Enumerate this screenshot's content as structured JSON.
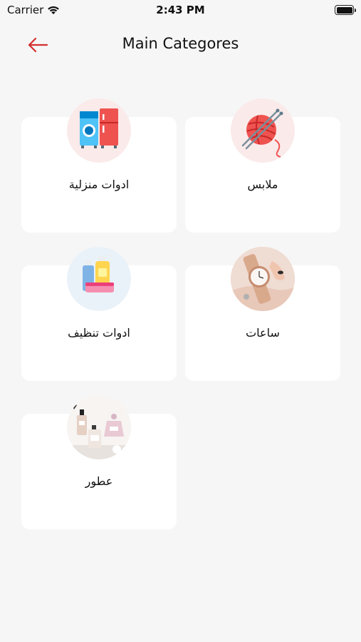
{
  "status_bar": {
    "carrier": "Carrier",
    "time": "2:43 PM"
  },
  "header": {
    "title": "Main Categores",
    "accent_color": "#d32f2f"
  },
  "categories": [
    {
      "label": "ملابس",
      "icon": "yarn-ball-icon"
    },
    {
      "label": "ادوات منزلية",
      "icon": "appliances-icon"
    },
    {
      "label": "ساعات",
      "icon": "watch-photo"
    },
    {
      "label": "ادوات تنظيف",
      "icon": "cleaning-products-icon"
    },
    {
      "label": "عطور",
      "icon": "perfume-photo"
    }
  ]
}
